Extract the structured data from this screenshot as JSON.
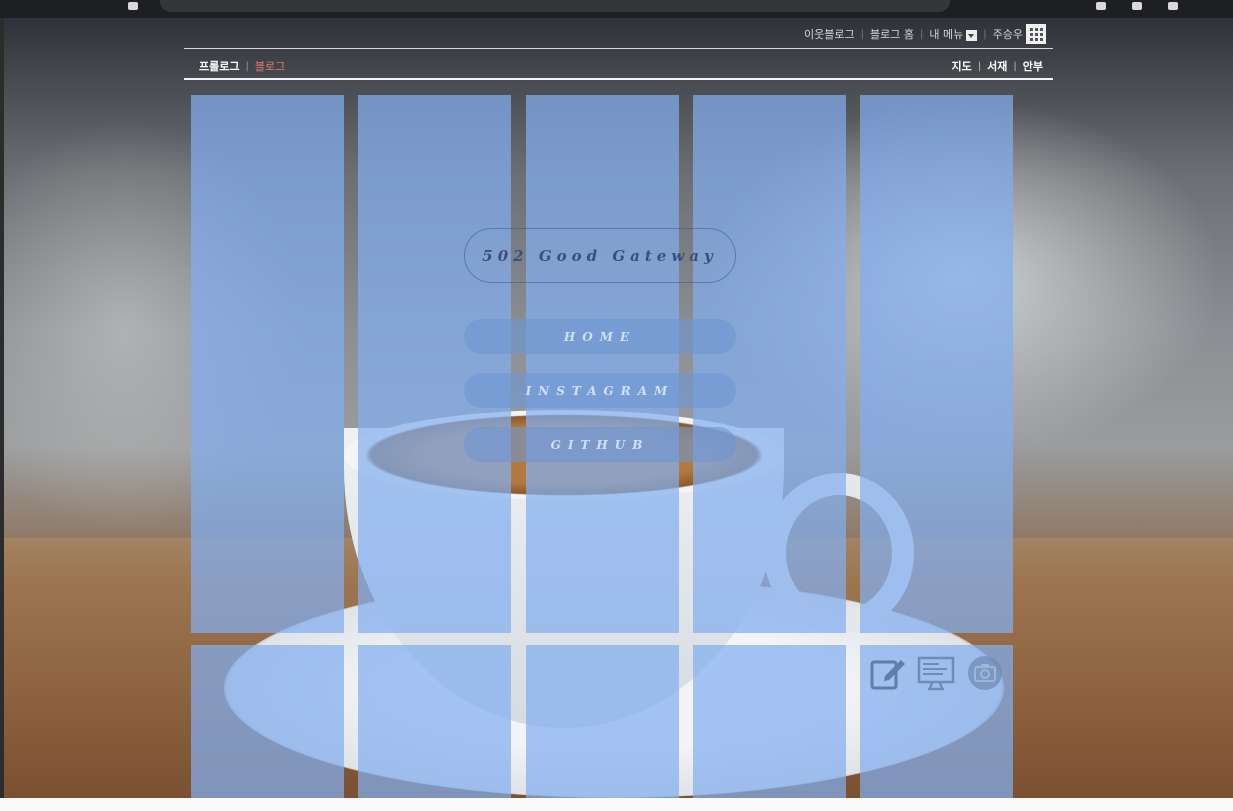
{
  "topnav": {
    "items": [
      "이웃블로그",
      "블로그 홈",
      "내 메뉴",
      "주승우"
    ]
  },
  "subnav": {
    "left_active": "프롤로그",
    "left_other": "블로그",
    "right": [
      "지도",
      "서재",
      "안부"
    ]
  },
  "blog": {
    "title": "502 Good Gateway",
    "menu": [
      "HOME",
      "INSTAGRAM",
      "GITHUB"
    ]
  },
  "tools": {
    "icons": [
      "write-icon",
      "admin-screen-icon",
      "camera-icon"
    ]
  },
  "colors": {
    "overlay": "#82AFEE",
    "accent_red": "#E57B6F"
  }
}
